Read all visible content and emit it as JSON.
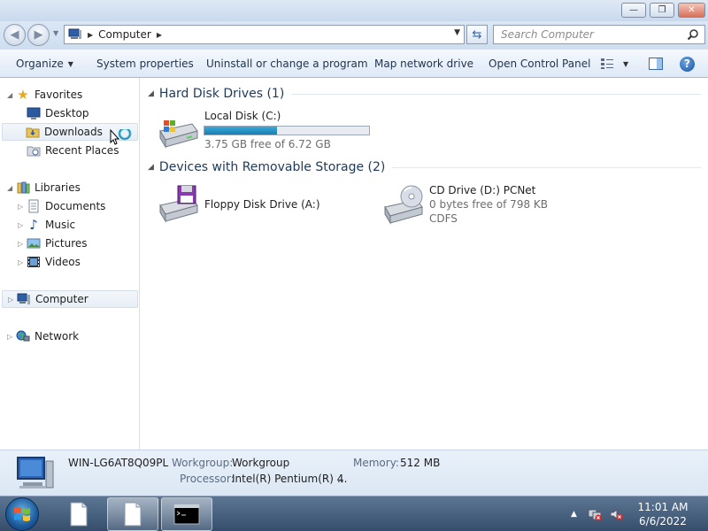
{
  "window": {
    "minimize_glyph": "—",
    "maximize_glyph": "❐",
    "close_glyph": "✕"
  },
  "address": {
    "breadcrumb": "Computer",
    "search_placeholder": "Search Computer"
  },
  "toolbar": {
    "organize": "Organize",
    "system_properties": "System properties",
    "uninstall": "Uninstall or change a program",
    "map_drive": "Map network drive",
    "control_panel": "Open Control Panel"
  },
  "nav": {
    "favorites": "Favorites",
    "desktop": "Desktop",
    "downloads": "Downloads",
    "recent_places": "Recent Places",
    "libraries": "Libraries",
    "documents": "Documents",
    "music": "Music",
    "pictures": "Pictures",
    "videos": "Videos",
    "computer": "Computer",
    "network": "Network"
  },
  "content": {
    "hdd_group": "Hard Disk Drives (1)",
    "local_disk": {
      "name": "Local Disk (C:)",
      "free": "3.75 GB free of 6.72 GB",
      "used_fraction": 0.44
    },
    "removable_group": "Devices with Removable Storage (2)",
    "floppy": {
      "name": "Floppy Disk Drive (A:)"
    },
    "cd": {
      "name": "CD Drive (D:) PCNet",
      "free": "0 bytes free of 798 KB",
      "fs": "CDFS"
    }
  },
  "details": {
    "computer_name": "WIN-LG6AT8Q09PL",
    "workgroup_label": "Workgroup:",
    "workgroup_value": "Workgroup",
    "memory_label": "Memory:",
    "memory_value": "512 MB",
    "processor_label": "Processor:",
    "processor_value": "Intel(R) Pentium(R) 4",
    "processor_more": "..."
  },
  "taskbar": {
    "time": "11:01 AM",
    "date": "6/6/2022",
    "tray_arrow": "▲"
  },
  "colors": {
    "accent": "#1e395b",
    "bar_fill": "#1e8fc4",
    "taskbar": "#3c5574"
  }
}
